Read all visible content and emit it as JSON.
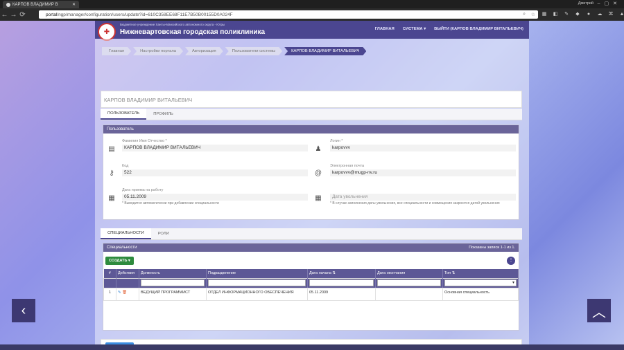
{
  "browser": {
    "tab_title": "КАРПОВ ВЛАДИМИР В",
    "user": "Дмитрий",
    "url_host": "portal",
    "url_path": "/ngp/manager/configuration/users/update?id=610C358EE68F11E7B50B00155D0A024F"
  },
  "header": {
    "org_sub": "Бюджетное учреждение Ханты-Мансийского автономного округа - Югры",
    "org_name": "Нижневартовская городская поликлиника",
    "menu": [
      "ГЛАВНАЯ",
      "СИСТЕМА ▾",
      "ВЫЙТИ (КАРПОВ ВЛАДИМИР ВИТАЛЬЕВИЧ)"
    ]
  },
  "breadcrumbs": [
    "Главная",
    "Настройки портала",
    "Авторизация",
    "Пользователи системы",
    "КАРПОВ ВЛАДИМИР ВИТАЛЬЕВИЧ"
  ],
  "page_title": "КАРПОВ ВЛАДИМИР ВИТАЛЬЕВИЧ",
  "tabs1": [
    "ПОЛЬЗОВАТЕЛЬ",
    "ПРОФИЛЬ"
  ],
  "user_panel": {
    "title": "Пользователь",
    "fio": {
      "label": "Фамилия Имя Отчество *",
      "value": "КАРПОВ ВЛАДИМИР ВИТАЛЬЕВИЧ"
    },
    "login": {
      "label": "Логин *",
      "value": "karpovvv"
    },
    "code": {
      "label": "Код",
      "value": "522"
    },
    "email": {
      "label": "Электронная почта",
      "value": "karpovvv@mugp-nv.ru"
    },
    "hire": {
      "label": "Дата приема на работу",
      "value": "05.11.2009",
      "hint": "* Выводится автоматически при добавлении специальности"
    },
    "fire": {
      "placeholder": "Дата увольнения",
      "hint": "* В случае заполнения даты увольнения, все специальности и совмещения закроются датой увольнения"
    }
  },
  "tabs2": [
    "СПЕЦИАЛЬНОСТИ",
    "РОЛИ"
  ],
  "spec": {
    "title": "Специальности",
    "count": "Показаны записи 1-1 из 1.",
    "create": "СОЗДАТЬ ▾",
    "columns": [
      "#",
      "Действия",
      "Должность",
      "Подразделение",
      "Дата начала ⇅",
      "Дата окончания",
      "Тип ⇅"
    ],
    "rows": [
      [
        "1",
        "",
        "ВЕДУЩИЙ ПРОГРАММИСТ",
        "ОТДЕЛ ИНФОРМАЦИОННОГО ОБЕСПЕЧЕНИЯ",
        "05.11.2009",
        "",
        "Основная специальность"
      ]
    ]
  },
  "save": "ОБНОВИТЬ",
  "icons": {
    "back": "chevron-left-icon",
    "up": "chevron-up-icon"
  }
}
